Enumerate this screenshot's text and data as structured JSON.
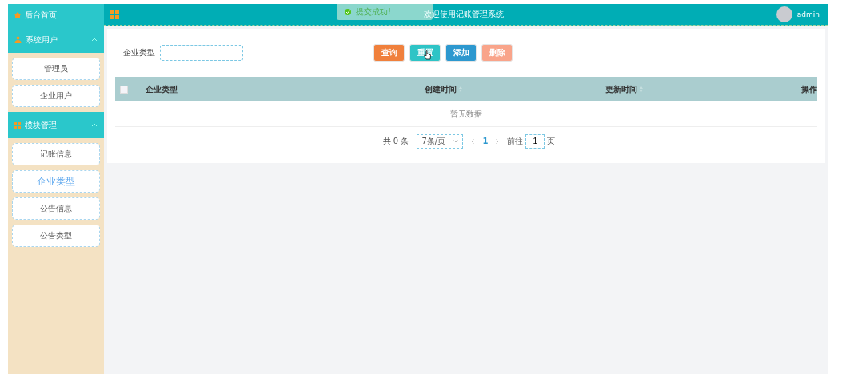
{
  "sidebar": {
    "home": {
      "label": "后台首页"
    },
    "groups": [
      {
        "label": "系统用户",
        "expanded": true,
        "items": [
          {
            "label": "管理员",
            "selected": false
          },
          {
            "label": "企业用户",
            "selected": false
          }
        ]
      },
      {
        "label": "模块管理",
        "expanded": true,
        "items": [
          {
            "label": "记账信息",
            "selected": false
          },
          {
            "label": "企业类型",
            "selected": true
          },
          {
            "label": "公告信息",
            "selected": false
          },
          {
            "label": "公告类型",
            "selected": false
          }
        ]
      }
    ]
  },
  "header": {
    "title": "欢迎使用记账管理系统",
    "user": "admin"
  },
  "toast": {
    "message": "提交成功!"
  },
  "search": {
    "label": "企业类型"
  },
  "buttons": [
    {
      "label": "查询",
      "kind": "search"
    },
    {
      "label": "重置",
      "kind": "reset"
    },
    {
      "label": "添加",
      "kind": "add"
    },
    {
      "label": "删除",
      "kind": "delete"
    }
  ],
  "table": {
    "select_all": {
      "checked": false
    },
    "columns": [
      {
        "label": "企业类型",
        "kind": "plain"
      },
      {
        "label": "创建时间",
        "kind": "sortable"
      },
      {
        "label": "更新时间",
        "kind": "sortable"
      },
      {
        "label": "操作",
        "kind": "plain"
      }
    ],
    "empty_text": "暂无数据"
  },
  "pagination": {
    "total": "共 0 条",
    "page_size": "7条/页",
    "pages": [
      {
        "label": "1",
        "selected": true
      }
    ],
    "goto_label": "前往",
    "goto_value": "1",
    "goto_suffix": "页"
  }
}
